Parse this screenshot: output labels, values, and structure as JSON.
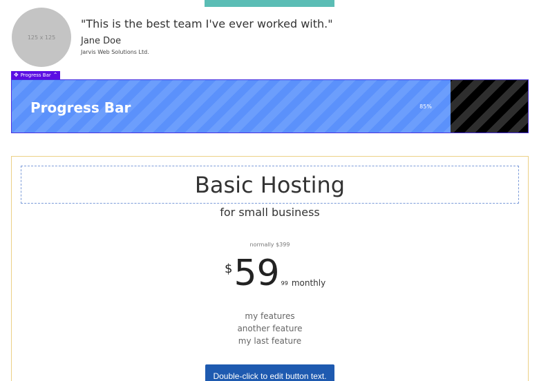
{
  "testimonial": {
    "avatar_placeholder": "125 x 125",
    "quote": "\"This is the best team I've ever worked with.\"",
    "author": "Jane Doe",
    "company": "Jarvis Web Solutions Ltd."
  },
  "progress_bar": {
    "tag_label": "Progress Bar",
    "title": "Progress Bar",
    "percent_text": "85%",
    "percent_value": 85,
    "colors": {
      "fill": "#5b91fb",
      "track": "#000000",
      "border": "#4a30e0",
      "tag": "#5b0ee3"
    }
  },
  "pricing": {
    "title": "Basic Hosting",
    "subtitle": "for small business",
    "normally": "normally $399",
    "currency": "$",
    "amount": "59",
    "cents": "99",
    "period": "monthly",
    "features": [
      "my features",
      "another feature",
      "my last feature"
    ],
    "button_label": "Double-click to edit button text.",
    "colors": {
      "button": "#1e5ab0",
      "border": "#ecd085"
    }
  },
  "colors": {
    "top_strip": "#5bbdb5"
  }
}
